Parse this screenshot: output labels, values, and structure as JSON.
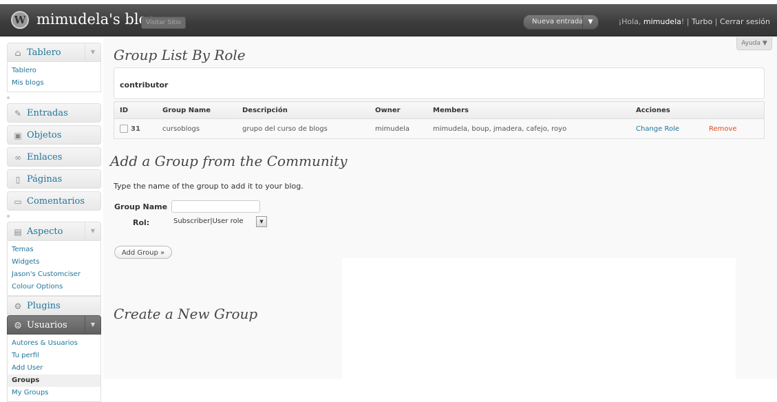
{
  "header": {
    "blog_name": "mimudela's blog",
    "visit_site": "Visitar Sitio",
    "new_post": "Nueva entrada",
    "greeting_prefix": "¡Hola, ",
    "user_name": "mimudela",
    "greeting_suffix": "! | ",
    "turbo": "Turbo",
    "divider": " | ",
    "logout": "Cerrar sesión"
  },
  "help": "Ayuda ▼",
  "sidebar": {
    "dashboard": {
      "label": "Tablero",
      "icon": "house-icon",
      "items": [
        "Tablero",
        "Mis blogs"
      ]
    },
    "posts": {
      "label": "Entradas",
      "icon": "pin-icon"
    },
    "media": {
      "label": "Objetos",
      "icon": "media-icon"
    },
    "links": {
      "label": "Enlaces",
      "icon": "link-icon"
    },
    "pages": {
      "label": "Páginas",
      "icon": "page-icon"
    },
    "comments": {
      "label": "Comentarios",
      "icon": "comment-icon"
    },
    "appearance": {
      "label": "Aspecto",
      "icon": "appearance-icon",
      "items": [
        "Temas",
        "Widgets",
        "Jason's Customciser",
        "Colour Options"
      ]
    },
    "plugins": {
      "label": "Plugins",
      "icon": "plug-icon"
    },
    "users": {
      "label": "Usuarios",
      "icon": "users-icon",
      "items": [
        "Autores & Usuarios",
        "Tu perfil",
        "Add User",
        "Groups",
        "My Groups"
      ]
    }
  },
  "main": {
    "title_list": "Group List By Role",
    "role": "contributor",
    "table": {
      "headers": [
        "ID",
        "Group Name",
        "Descripción",
        "Owner",
        "Members",
        "Acciones"
      ],
      "rows": [
        {
          "id": "31",
          "name": "cursoblogs",
          "description": "grupo del curso de blogs",
          "owner": "mimudela",
          "members": "mimudela, boup, jmadera, cafejo, royo",
          "action_change": "Change Role",
          "action_remove": "Remove"
        }
      ]
    },
    "title_add": "Add a Group from the Community",
    "add_desc": "Type the name of the group to add it to your blog.",
    "group_name_label": "Group Name",
    "group_name_value": "",
    "role_label": "Rol:",
    "role_value": "Subscriber|User role",
    "add_button": "Add Group »",
    "title_create": "Create a New Group"
  },
  "colors": {
    "link": "#21759b",
    "remove": "#d54e21",
    "header_bg": "#464646"
  }
}
